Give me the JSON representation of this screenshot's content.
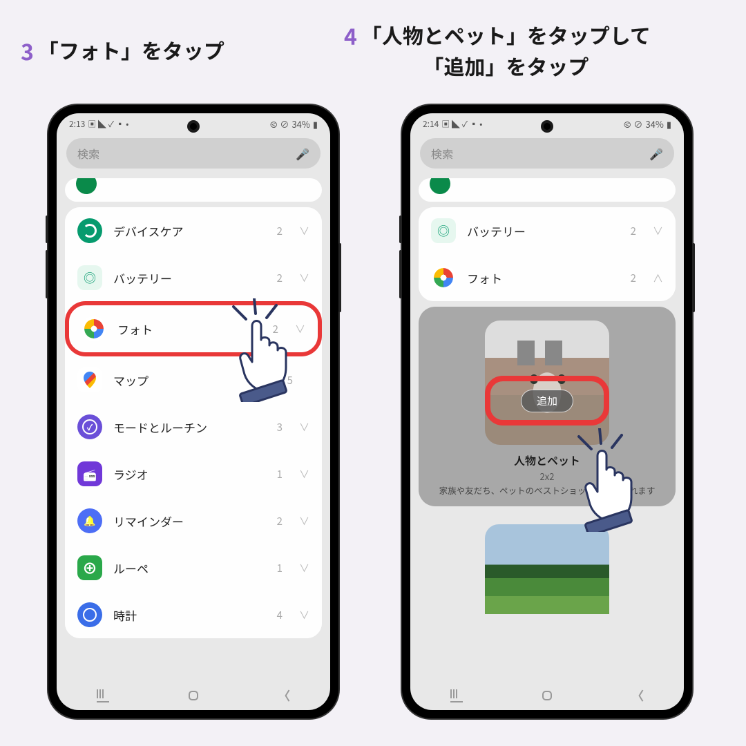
{
  "steps": {
    "s3": {
      "num": "3",
      "text": "「フォト」をタップ"
    },
    "s4": {
      "num": "4",
      "text": "「人物とペット」をタップして\n「追加」をタップ"
    }
  },
  "status": {
    "left_time": "2:13",
    "right_time": "2:14",
    "batt": "34%"
  },
  "search": {
    "placeholder": "検索"
  },
  "apps_left": [
    {
      "label": "デバイスケア",
      "count": "2",
      "chev": "∨",
      "ic": "ic-device"
    },
    {
      "label": "バッテリー",
      "count": "2",
      "chev": "∨",
      "ic": "ic-battery"
    },
    {
      "label": "フォト",
      "count": "2",
      "chev": "∨",
      "ic": "ic-photos-wrap",
      "highlight": true
    },
    {
      "label": "マップ",
      "count": "5",
      "chev": "",
      "ic": "ic-maps"
    },
    {
      "label": "モードとルーチン",
      "count": "3",
      "chev": "∨",
      "ic": "ic-modes"
    },
    {
      "label": "ラジオ",
      "count": "1",
      "chev": "∨",
      "ic": "ic-radio"
    },
    {
      "label": "リマインダー",
      "count": "2",
      "chev": "∨",
      "ic": "ic-reminder"
    },
    {
      "label": "ルーペ",
      "count": "1",
      "chev": "∨",
      "ic": "ic-loupe"
    },
    {
      "label": "時計",
      "count": "4",
      "chev": "∨",
      "ic": "ic-clock"
    }
  ],
  "apps_right": [
    {
      "label": "バッテリー",
      "count": "2",
      "chev": "∨",
      "ic": "ic-battery"
    },
    {
      "label": "フォト",
      "count": "2",
      "chev": "∧",
      "ic": "ic-photos-wrap"
    }
  ],
  "widget": {
    "add": "追加",
    "title": "人物とペット",
    "size": "2x2",
    "desc": "家族や友だち、ペットのベストショットが表示されます"
  }
}
